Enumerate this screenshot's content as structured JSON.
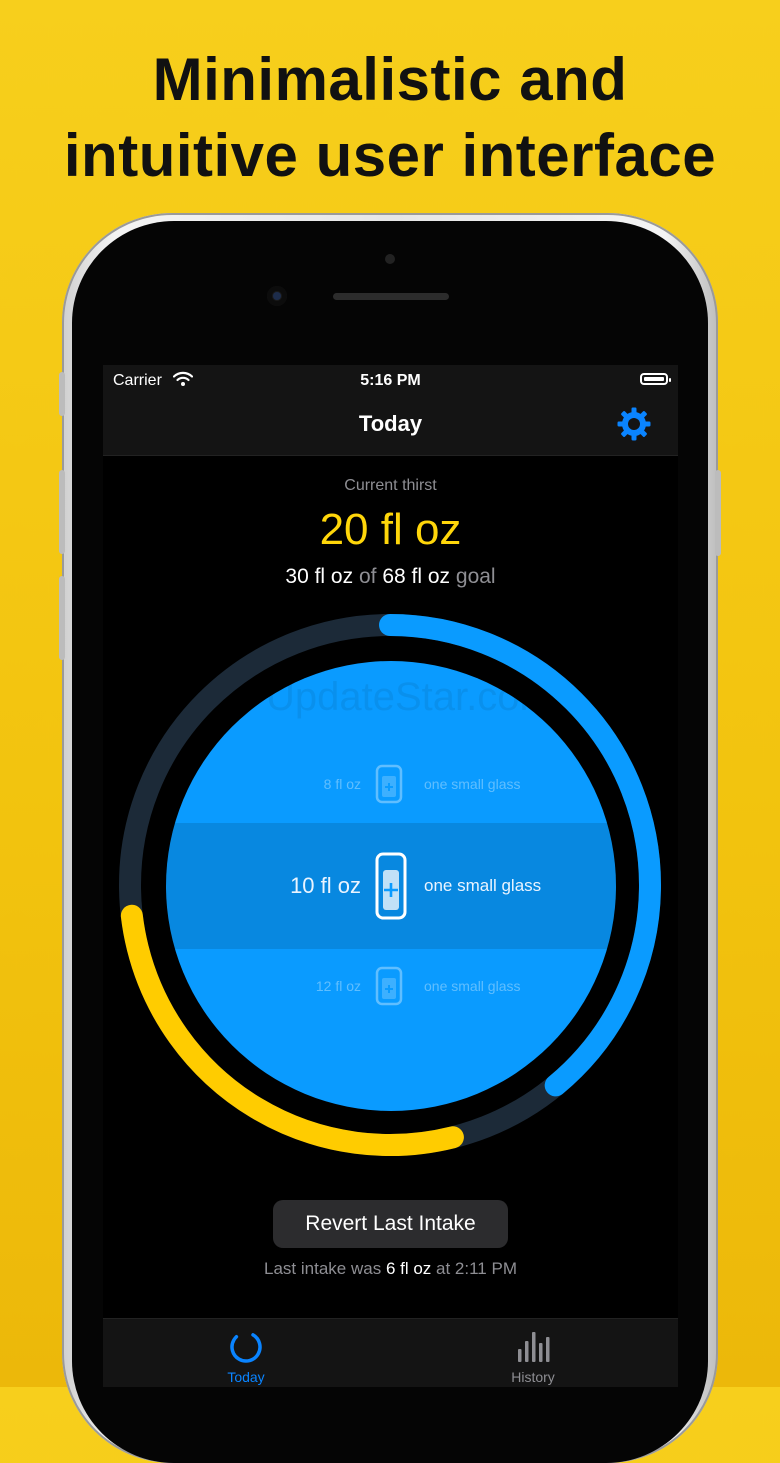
{
  "promo": {
    "headline_line1": "Minimalistic and",
    "headline_line2": "intuitive user interface"
  },
  "status_bar": {
    "carrier": "Carrier",
    "time": "5:16 PM"
  },
  "nav": {
    "title": "Today",
    "settings_icon": "gear-icon"
  },
  "summary": {
    "label": "Current thirst",
    "value": "20 fl oz",
    "consumed": "30 fl oz",
    "of_word": "of",
    "goal": "68 fl oz",
    "goal_word": "goal"
  },
  "progress": {
    "consumed_fraction": 0.44,
    "consumed_color": "#ffcc00",
    "remaining_color": "#0a9bff",
    "track_color": "#1c2a38"
  },
  "watermark": "UpdateStar.com",
  "picker": {
    "rows": [
      {
        "amount": "8 fl oz",
        "description": "one small glass"
      },
      {
        "amount": "10 fl oz",
        "description": "one small glass"
      },
      {
        "amount": "12 fl oz",
        "description": "one small glass"
      }
    ],
    "glass_icon": "glass-plus-icon",
    "color": "#0a9bff"
  },
  "actions": {
    "revert_label": "Revert Last Intake",
    "last_intake_prefix": "Last intake was",
    "last_intake_amount": "6 fl oz",
    "last_intake_suffix": "at 2:11 PM"
  },
  "tabs": [
    {
      "label": "Today",
      "icon": "ring-progress-icon",
      "active": true
    },
    {
      "label": "History",
      "icon": "bar-chart-icon",
      "active": false
    }
  ],
  "colors": {
    "background": "#f5c814",
    "accent_blue": "#0a84ff",
    "accent_yellow": "#ffd60a"
  }
}
